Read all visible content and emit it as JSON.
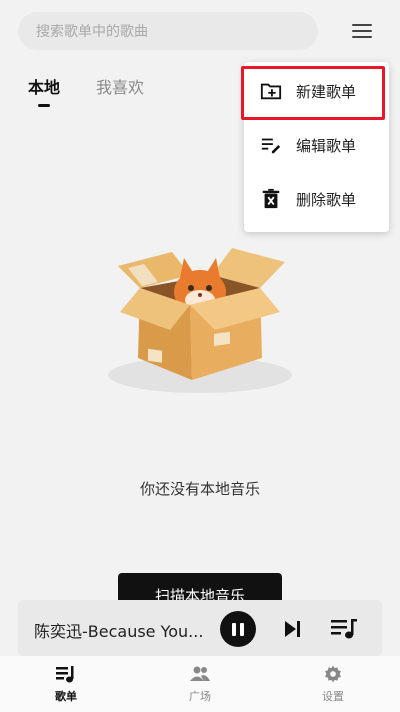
{
  "search": {
    "placeholder": "搜索歌单中的歌曲"
  },
  "tabs": [
    {
      "label": "本地",
      "active": true
    },
    {
      "label": "我喜欢",
      "active": false
    }
  ],
  "dropdown": {
    "items": [
      {
        "label": "新建歌单",
        "icon": "folder-plus-icon",
        "highlighted": true
      },
      {
        "label": "编辑歌单",
        "icon": "edit-list-icon",
        "highlighted": false
      },
      {
        "label": "删除歌单",
        "icon": "trash-icon",
        "highlighted": false
      }
    ],
    "highlight_color": "#e8182a"
  },
  "empty_state": {
    "message": "你还没有本地音乐",
    "illustration": "cat-in-box"
  },
  "scan_button": {
    "label": "扫描本地音乐"
  },
  "player": {
    "title": "陈奕迅-Because You...",
    "state": "playing"
  },
  "bottom_nav": [
    {
      "label": "歌单",
      "icon": "playlist-icon",
      "active": true
    },
    {
      "label": "广场",
      "icon": "people-icon",
      "active": false
    },
    {
      "label": "设置",
      "icon": "gear-icon",
      "active": false
    }
  ]
}
